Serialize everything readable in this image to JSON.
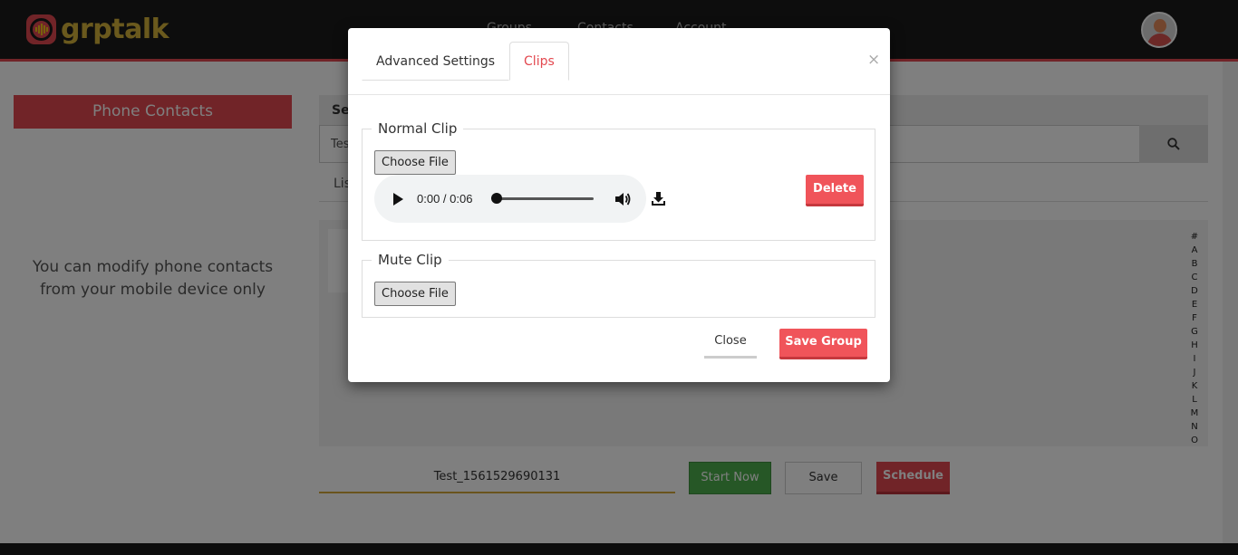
{
  "app": {
    "logo_text": "grptalk",
    "nav": [
      "Groups",
      "Contacts",
      "Account"
    ],
    "accent_color": "#e34950"
  },
  "left_panel": {
    "title": "Phone Contacts",
    "message": "You can modify phone contacts from your mobile device only"
  },
  "search": {
    "heading": "Search",
    "value": "Test",
    "list_tab": "List"
  },
  "alphabet": [
    "#",
    "A",
    "B",
    "C",
    "D",
    "E",
    "F",
    "G",
    "H",
    "I",
    "J",
    "K",
    "L",
    "M",
    "N",
    "O"
  ],
  "footer": {
    "group_name": "Test_1561529690131",
    "start_now": "Start Now",
    "save": "Save",
    "schedule": "Schedule"
  },
  "modal": {
    "tabs": [
      "Advanced Settings",
      "Clips"
    ],
    "active_tab": "Clips",
    "close_symbol": "×",
    "normal_clip": {
      "legend": "Normal Clip",
      "file_button": "Choose File",
      "player_time": "0:00 / 0:06",
      "progress": 0,
      "delete_label": "Delete"
    },
    "mute_clip": {
      "legend": "Mute Clip",
      "file_button": "Choose File"
    },
    "close_label": "Close",
    "save_group_label": "Save Group"
  }
}
